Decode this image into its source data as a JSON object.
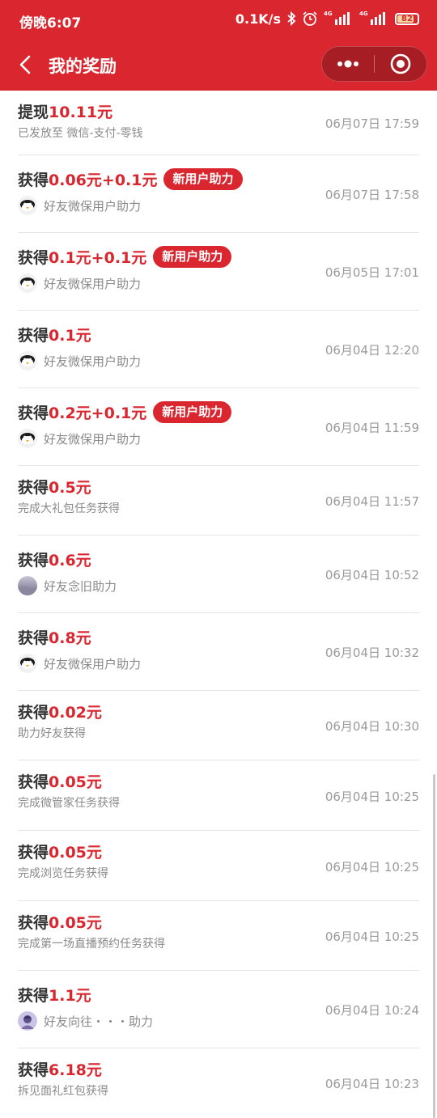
{
  "status_bar": {
    "time": "傍晚6:07",
    "speed": "0.1K/s",
    "signal_label_1": "4G",
    "signal_label_2": "4G",
    "battery": "82",
    "icons": [
      "bluetooth-icon",
      "alarm-icon",
      "signal-icon",
      "signal-icon",
      "battery-icon"
    ]
  },
  "nav": {
    "title": "我的奖励",
    "back_icon": "chevron-left-icon",
    "more_icon": "more-dots-icon",
    "close_icon": "target-circle-icon"
  },
  "colors": {
    "brand_red": "#d9262f",
    "capsule": "#a61d24"
  },
  "records": [
    {
      "verb": "提现",
      "amount": "10.11元",
      "badge": "",
      "avatar": "",
      "desc": "已发放至 微信-支付-零钱",
      "time": "06月07日 17:59"
    },
    {
      "verb": "获得",
      "amount": "0.06元+0.1元",
      "badge": "新用户助力",
      "avatar": "penguin",
      "desc": "好友微保用户助力",
      "time": "06月07日 17:58"
    },
    {
      "verb": "获得",
      "amount": "0.1元+0.1元",
      "badge": "新用户助力",
      "avatar": "penguin",
      "desc": "好友微保用户助力",
      "time": "06月05日 17:01"
    },
    {
      "verb": "获得",
      "amount": "0.1元",
      "badge": "",
      "avatar": "penguin",
      "desc": "好友微保用户助力",
      "time": "06月04日 12:20"
    },
    {
      "verb": "获得",
      "amount": "0.2元+0.1元",
      "badge": "新用户助力",
      "avatar": "penguin",
      "desc": "好友微保用户助力",
      "time": "06月04日 11:59"
    },
    {
      "verb": "获得",
      "amount": "0.5元",
      "badge": "",
      "avatar": "",
      "desc": "完成大礼包任务获得",
      "time": "06月04日 11:57"
    },
    {
      "verb": "获得",
      "amount": "0.6元",
      "badge": "",
      "avatar": "landscape",
      "desc": "好友念旧助力",
      "time": "06月04日 10:52"
    },
    {
      "verb": "获得",
      "amount": "0.8元",
      "badge": "",
      "avatar": "penguin",
      "desc": "好友微保用户助力",
      "time": "06月04日 10:32"
    },
    {
      "verb": "获得",
      "amount": "0.02元",
      "badge": "",
      "avatar": "",
      "desc": "助力好友获得",
      "time": "06月04日 10:30"
    },
    {
      "verb": "获得",
      "amount": "0.05元",
      "badge": "",
      "avatar": "",
      "desc": "完成微管家任务获得",
      "time": "06月04日 10:25"
    },
    {
      "verb": "获得",
      "amount": "0.05元",
      "badge": "",
      "avatar": "",
      "desc": "完成浏览任务获得",
      "time": "06月04日 10:25"
    },
    {
      "verb": "获得",
      "amount": "0.05元",
      "badge": "",
      "avatar": "",
      "desc": "完成第一场直播预约任务获得",
      "time": "06月04日 10:25"
    },
    {
      "verb": "获得",
      "amount": "1.1元",
      "badge": "",
      "avatar": "person",
      "desc": "好友向往・・・助力",
      "time": "06月04日 10:24"
    },
    {
      "verb": "获得",
      "amount": "6.18元",
      "badge": "",
      "avatar": "",
      "desc": "拆见面礼红包获得",
      "time": "06月04日 10:23"
    }
  ]
}
